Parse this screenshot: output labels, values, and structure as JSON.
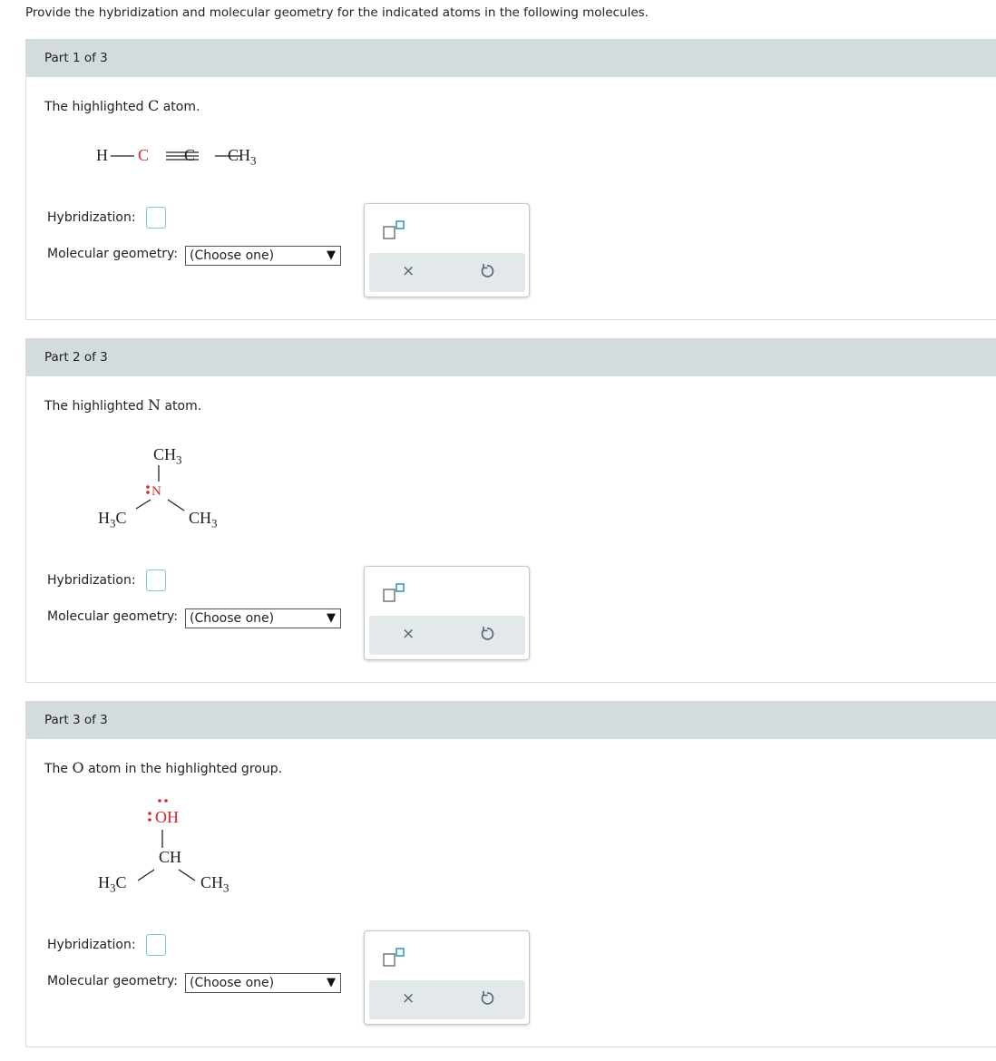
{
  "instructions": "Provide the hybridization and molecular geometry for the indicated atoms in the following molecules.",
  "labels": {
    "hybridization": "Hybridization:",
    "geometry": "Molecular geometry:",
    "choose": "(Choose one)"
  },
  "parts": [
    {
      "header": "Part 1 of 3",
      "prompt_pre": "The highlighted ",
      "prompt_atom": "C",
      "prompt_post": " atom.",
      "molecule": {
        "h": "H",
        "c1": "C",
        "c2": "C",
        "ch": "CH",
        "sub": "3"
      }
    },
    {
      "header": "Part 2 of 3",
      "prompt_pre": "The highlighted ",
      "prompt_atom": "N",
      "prompt_post": " atom.",
      "molecule": {
        "top": "CH",
        "top_sub": "3",
        "n": "N",
        "left_h": "H",
        "left_sub": "3",
        "left_c": "C",
        "right": "CH",
        "right_sub": "3"
      }
    },
    {
      "header": "Part 3 of 3",
      "prompt_pre": "The ",
      "prompt_atom": "O",
      "prompt_post": " atom in the highlighted group.",
      "molecule": {
        "oh": "OH",
        "ch_mid": "CH",
        "left_h": "H",
        "left_sub": "3",
        "left_c": "C",
        "right": "CH",
        "right_sub": "3"
      }
    }
  ],
  "tool": {
    "superscript_icon": "superscript-box-icon",
    "clear_icon": "x-icon",
    "clear_glyph": "×",
    "reset_icon": "undo-icon"
  },
  "colors": {
    "highlight": "#d8262a",
    "header_bg": "#d3dbde",
    "answer_border": "#7ec4d8",
    "tool_bar": "#e3e8ea"
  }
}
